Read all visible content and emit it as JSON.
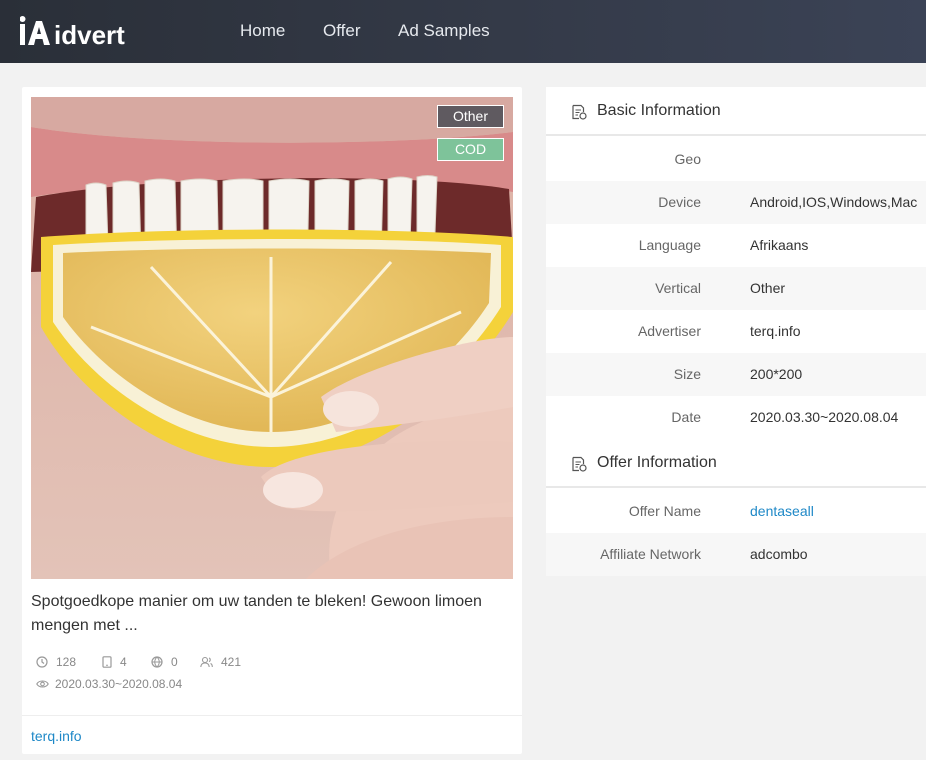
{
  "header": {
    "logo_text": "idvert",
    "nav": [
      {
        "label": "Home"
      },
      {
        "label": "Offer"
      },
      {
        "label": "Ad Samples"
      }
    ]
  },
  "ad": {
    "tags": [
      "Other",
      "COD"
    ],
    "text": "Spotgoedkope manier om uw tanden te bleken! Gewoon limoen mengen met ...",
    "stats": {
      "clock": "128",
      "device": "4",
      "globe": "0",
      "users": "421",
      "date_range": "2020.03.30~2020.08.04"
    },
    "advertiser": "terq.info"
  },
  "basic_info": {
    "title": "Basic Information",
    "rows": [
      {
        "label": "Geo",
        "value": ""
      },
      {
        "label": "Device",
        "value": "Android,IOS,Windows,Mac"
      },
      {
        "label": "Language",
        "value": "Afrikaans"
      },
      {
        "label": "Vertical",
        "value": "Other"
      },
      {
        "label": "Advertiser",
        "value": "terq.info"
      },
      {
        "label": "Size",
        "value": "200*200"
      },
      {
        "label": "Date",
        "value": "2020.03.30~2020.08.04"
      }
    ]
  },
  "offer_info": {
    "title": "Offer Information",
    "rows": [
      {
        "label": "Offer Name",
        "value": "dentaseall"
      },
      {
        "label": "Affiliate Network",
        "value": "adcombo"
      }
    ]
  },
  "colors": {
    "header_bg": "#2f3541",
    "link": "#1e88c7",
    "tag_other": "#5f5a60",
    "tag_cod": "#7ec39a"
  }
}
